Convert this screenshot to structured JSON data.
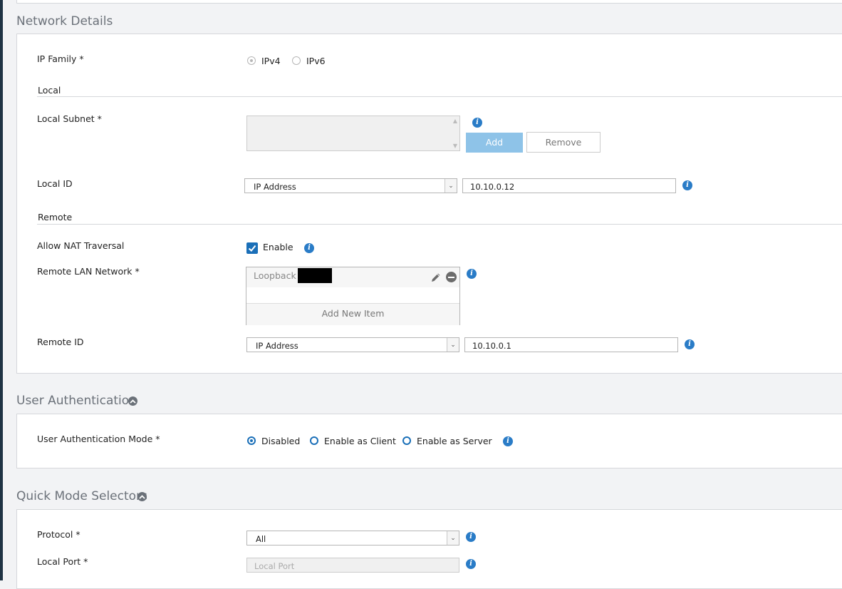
{
  "sections": {
    "network": {
      "title": "Network Details",
      "ip_family": {
        "label": "IP Family *",
        "options": [
          "IPv4",
          "IPv6"
        ],
        "selected": "IPv4"
      },
      "local": {
        "heading": "Local",
        "subnet": {
          "label": "Local Subnet *",
          "add_label": "Add",
          "remove_label": "Remove"
        },
        "local_id": {
          "label": "Local ID",
          "type": "IP Address",
          "value": "10.10.0.12"
        }
      },
      "remote": {
        "heading": "Remote",
        "nat": {
          "label": "Allow NAT Traversal",
          "checkbox_label": "Enable",
          "checked": true
        },
        "lan": {
          "label": "Remote LAN Network *",
          "items": [
            "Loopback"
          ],
          "add_new_label": "Add New Item"
        },
        "remote_id": {
          "label": "Remote ID",
          "type": "IP Address",
          "value": "10.10.0.1"
        }
      }
    },
    "user_auth": {
      "title": "User Authentication",
      "mode": {
        "label": "User Authentication Mode *",
        "options": [
          "Disabled",
          "Enable as Client",
          "Enable as Server"
        ],
        "selected": "Disabled"
      }
    },
    "quick_mode": {
      "title": "Quick Mode Selectors",
      "protocol": {
        "label": "Protocol *",
        "value": "All"
      },
      "local_port": {
        "label": "Local Port *",
        "placeholder": "Local Port"
      }
    }
  },
  "colors": {
    "accent": "#1a6fb8",
    "info": "#2a7cc7",
    "add_button": "#8ec3e8"
  },
  "icons": [
    "info-icon",
    "pencil-icon",
    "minus-circle-icon",
    "chevron-up-icon",
    "checkmark-icon",
    "chevron-down-icon"
  ]
}
